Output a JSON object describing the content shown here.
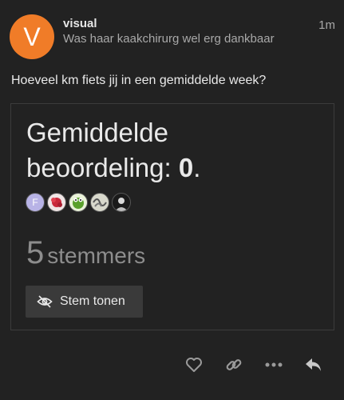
{
  "post": {
    "avatar_letter": "V",
    "username": "visual",
    "user_title": "Was haar kaakchirurg wel erg dankbaar",
    "age": "1m",
    "question": "Hoeveel km fiets jij in een gemiddelde week?"
  },
  "poll": {
    "average_label": "Gemiddelde beoordeling: ",
    "average_value": "0",
    "average_suffix": ".",
    "voter_initial": "F",
    "voter_count": "5",
    "voter_word": "stemmers",
    "show_results_label": "Stem tonen"
  },
  "colors": {
    "avatar": "#f07c28",
    "background": "#222222"
  },
  "icons": [
    "eye-slash-icon",
    "heart-icon",
    "link-icon",
    "ellipsis-icon",
    "reply-icon"
  ]
}
